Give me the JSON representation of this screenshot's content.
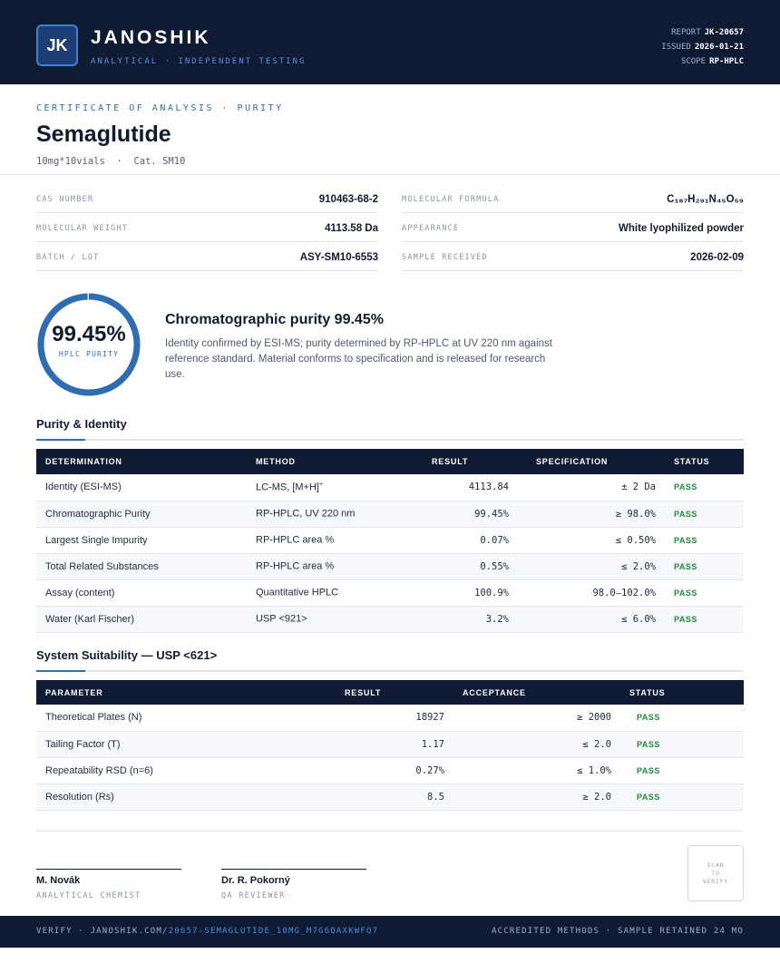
{
  "header": {
    "logo_text": "JK",
    "brand": "JANOSHIK",
    "tagline": "ANALYTICAL · INDEPENDENT TESTING",
    "report_label": "REPORT",
    "report_value": "JK-20657",
    "issued_label": "ISSUED",
    "issued_value": "2026-01-21",
    "scope_label": "SCOPE",
    "scope_value": "RP-HPLC"
  },
  "title": {
    "coa_label": "CERTIFICATE OF ANALYSIS · PURITY",
    "product": "Semaglutide",
    "subline": "10mg*10vials  ·  Cat. SM10"
  },
  "info": {
    "left": [
      {
        "key": "CAS NUMBER",
        "value": "910463-68-2"
      },
      {
        "key": "MOLECULAR WEIGHT",
        "value": "4113.58 Da"
      },
      {
        "key": "BATCH / LOT",
        "value": "ASY-SM10-6553"
      }
    ],
    "right": [
      {
        "key": "MOLECULAR FORMULA",
        "value": "C₁₈₇H₂₉₁N₄₅O₅₉"
      },
      {
        "key": "APPEARANCE",
        "value": "White lyophilized powder"
      },
      {
        "key": "SAMPLE RECEIVED",
        "value": "2026-02-09"
      }
    ]
  },
  "purity": {
    "value_text": "99.45%",
    "fraction": 0.9945,
    "label": "HPLC PURITY",
    "ring_color": "#2f6db3",
    "summary_title": "Chromatographic purity 99.45%",
    "summary_text": "Identity confirmed by ESI-MS; purity determined by RP-HPLC at UV 220 nm against reference standard. Material conforms to specification and is released for research use."
  },
  "purity_identity": {
    "title": "Purity & Identity",
    "headers": [
      "DETERMINATION",
      "METHOD",
      "RESULT",
      "SPECIFICATION",
      "STATUS"
    ],
    "rows": [
      {
        "determination": "Identity (ESI-MS)",
        "method": "LC-MS, [M+H]",
        "method_sup": "+",
        "result": "4113.84",
        "spec": "± 2 Da",
        "status": "PASS"
      },
      {
        "determination": "Chromatographic Purity",
        "method": "RP-HPLC, UV 220 nm",
        "method_sup": "",
        "result": "99.45%",
        "spec": "≥ 98.0%",
        "status": "PASS"
      },
      {
        "determination": "Largest Single Impurity",
        "method": "RP-HPLC area %",
        "method_sup": "",
        "result": "0.07%",
        "spec": "≤ 0.50%",
        "status": "PASS"
      },
      {
        "determination": "Total Related Substances",
        "method": "RP-HPLC area %",
        "method_sup": "",
        "result": "0.55%",
        "spec": "≤ 2.0%",
        "status": "PASS"
      },
      {
        "determination": "Assay (content)",
        "method": "Quantitative HPLC",
        "method_sup": "",
        "result": "100.9%",
        "spec": "98.0–102.0%",
        "status": "PASS"
      },
      {
        "determination": "Water (Karl Fischer)",
        "method": "USP <921>",
        "method_sup": "",
        "result": "3.2%",
        "spec": "≤ 6.0%",
        "status": "PASS"
      }
    ]
  },
  "system_suitability": {
    "title": "System Suitability — USP <621>",
    "headers": [
      "PARAMETER",
      "RESULT",
      "ACCEPTANCE",
      "STATUS"
    ],
    "rows": [
      {
        "parameter": "Theoretical Plates (N)",
        "result": "18927",
        "acceptance": "≥ 2000",
        "status": "PASS"
      },
      {
        "parameter": "Tailing Factor (T)",
        "result": "1.17",
        "acceptance": "≤ 2.0",
        "status": "PASS"
      },
      {
        "parameter": "Repeatability RSD (n=6)",
        "result": "0.27%",
        "acceptance": "≤ 1.0%",
        "status": "PASS"
      },
      {
        "parameter": "Resolution (Rs)",
        "result": "8.5",
        "acceptance": "≥ 2.0",
        "status": "PASS"
      }
    ]
  },
  "signatures": [
    {
      "name": "M. Novák",
      "role": "ANALYTICAL CHEMIST"
    },
    {
      "name": "Dr. R. Pokorný",
      "role": "QA REVIEWER"
    }
  ],
  "qr": {
    "line1": "SCAN",
    "line2": "TO",
    "line3": "VERIFY"
  },
  "footer": {
    "verify_prefix": "VERIFY · JANOSHIK.COM/",
    "verify_link": "20657-SEMAGLUTIDE_10MG_M7G6QAXKWFQ7",
    "right_text": "ACCREDITED METHODS · SAMPLE RETAINED 24 MO"
  },
  "colors": {
    "navy": "#0f1b33",
    "accent": "#2f6db3",
    "pass": "#1f8a3b"
  }
}
